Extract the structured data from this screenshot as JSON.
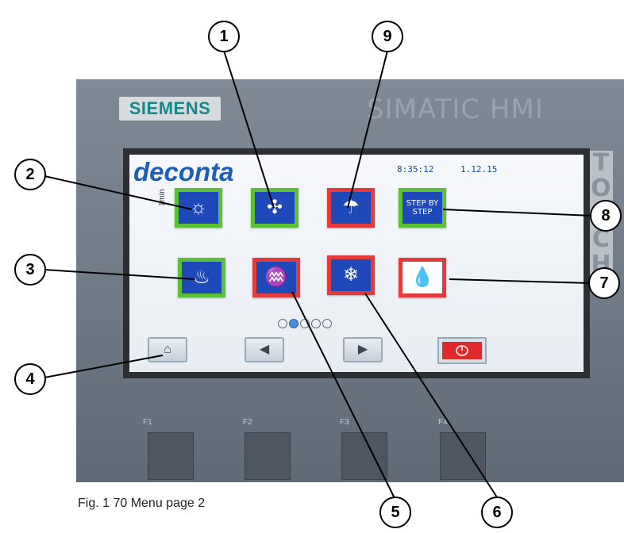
{
  "device": {
    "brand": "SIEMENS",
    "model_label": "SIMATIC HMI",
    "side_label": "TOUCH"
  },
  "screen": {
    "logo": "deconta",
    "time": "8:35:12",
    "date": "1.12.15",
    "side_note": "1min",
    "tiles": [
      {
        "icon": "lightbulb-icon",
        "glyph": "☼",
        "frame": "green"
      },
      {
        "icon": "fan-icon",
        "glyph": "✣",
        "frame": "green"
      },
      {
        "icon": "shower-person-icon",
        "glyph": "☂",
        "frame": "red"
      },
      {
        "icon": "step-by-step-icon",
        "text": "STEP BY STEP",
        "frame": "green"
      },
      {
        "icon": "flame-icon",
        "glyph": "♨",
        "frame": "green"
      },
      {
        "icon": "heater-icon",
        "glyph": "♒",
        "frame": "red"
      },
      {
        "icon": "snowflake-icon",
        "glyph": "❄",
        "frame": "red"
      },
      {
        "icon": "water-drop-icon",
        "glyph": "💧",
        "frame": "red"
      }
    ],
    "page_indicator": {
      "pages": 5,
      "current": 2
    }
  },
  "nav": {
    "home_icon": "home-icon",
    "prev_icon": "arrow-left-icon",
    "next_icon": "arrow-right-icon",
    "power_icon": "power-icon"
  },
  "function_keys": [
    "F1",
    "F2",
    "F3",
    "F4"
  ],
  "callouts": [
    "1",
    "2",
    "3",
    "4",
    "5",
    "6",
    "7",
    "8",
    "9"
  ],
  "caption": "Fig. 1 70 Menu page 2",
  "colors": {
    "tile_blue": "#1f48b8",
    "frame_green": "#59c038",
    "frame_red": "#e23b3b",
    "logo_blue": "#1b5fbd",
    "brand_teal": "#138a8a"
  }
}
